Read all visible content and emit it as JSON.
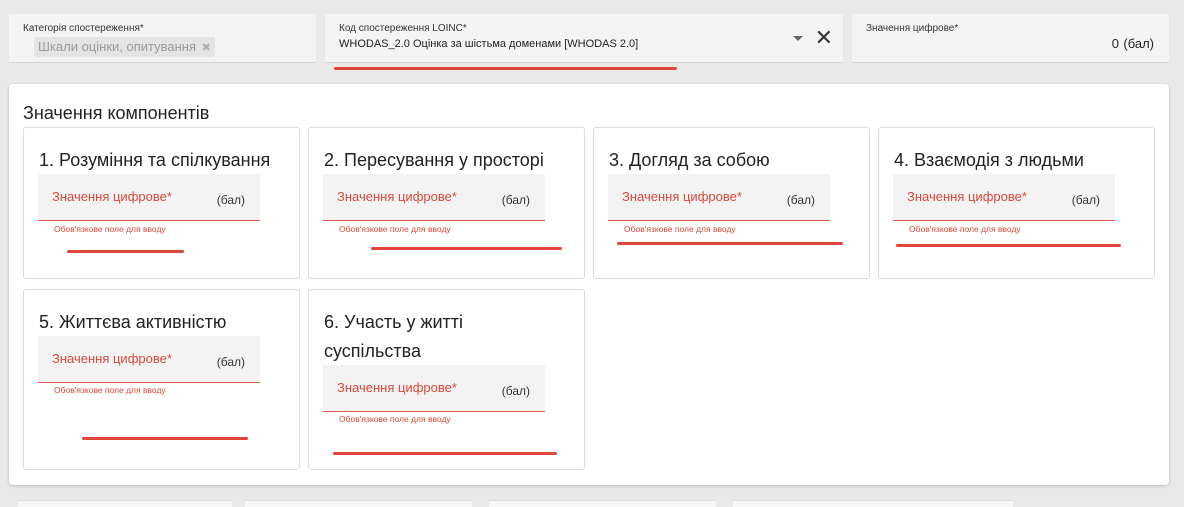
{
  "observation_category": {
    "label": "Категорія спостереження*",
    "chip": "Шкали оцінки, опитування",
    "chip_remove": "✖"
  },
  "loinc_code": {
    "label": "Код спостереження LOINC*",
    "value": "WHODAS_2.0  Оцінка за шістьма доменами [WHODAS 2.0]",
    "clear": "✕"
  },
  "numeric_value": {
    "label": "Значення цифрове*",
    "value": "0",
    "unit": "(бал)"
  },
  "components": {
    "title": "Значення компонентів",
    "field_label": "Значення цифрове*",
    "field_unit": "(бал)",
    "error": "Обов'язкове поле для вводу",
    "items": [
      {
        "title": "1. Розуміння та спілкування"
      },
      {
        "title": "2. Пересування у просторі"
      },
      {
        "title": "3. Догляд за собою"
      },
      {
        "title": "4. Взаємодія з людьми"
      },
      {
        "title": "5. Життєва активністю"
      },
      {
        "title": "6. Участь у житті суспільства"
      }
    ]
  },
  "colors": {
    "accent_error": "#d9493b",
    "annotation_stroke": "#e2453b",
    "background": "#e9e9e9"
  }
}
